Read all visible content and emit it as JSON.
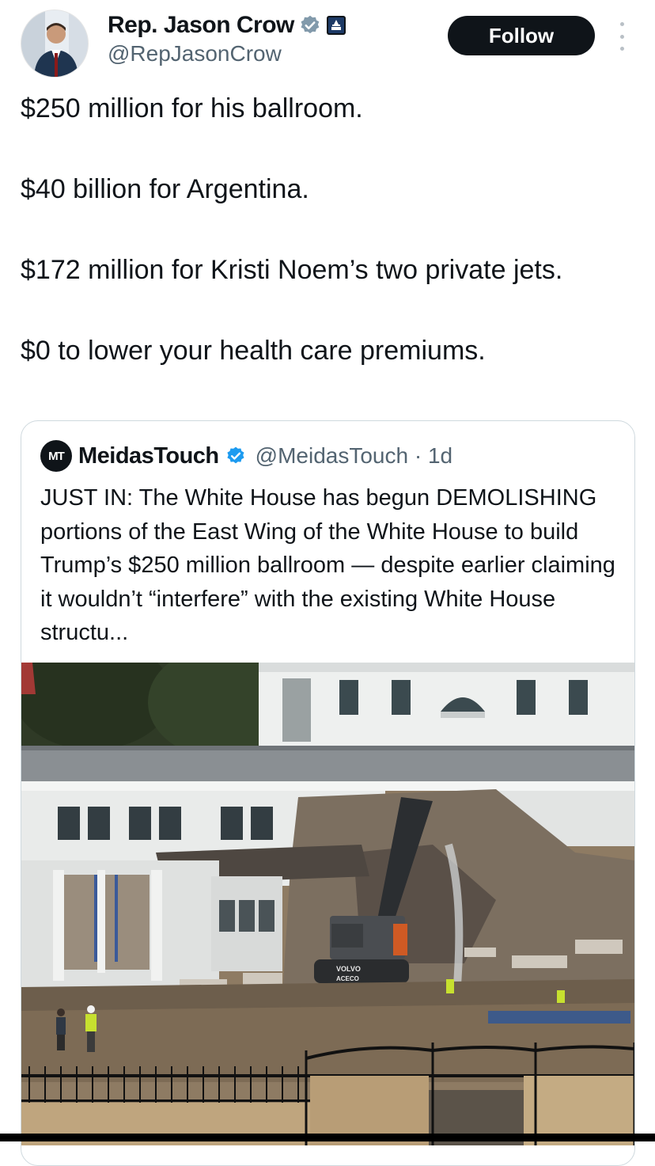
{
  "author": {
    "name": "Rep. Jason Crow",
    "handle": "@RepJasonCrow",
    "verified_color": "#829aab",
    "badge_icon": "capitol-icon"
  },
  "follow_label": "Follow",
  "tweet": {
    "paragraphs": [
      "$250 million for his ballroom.",
      "$40 billion for Argentina.",
      "$172 million for Kristi Noem’s two private jets.",
      "$0 to lower your health care premiums."
    ]
  },
  "quote": {
    "logo_text": "MT",
    "name": "MeidasTouch",
    "verified_color": "#1d9bf0",
    "meta": "@MeidasTouch · 1d",
    "text": "JUST IN: The White House has begun DEMOLISHING portions of the East Wing of the White House to build Trump’s $250 million ballroom — despite earlier claiming it wouldn’t “interfere” with the existing White House structu...",
    "image_labels": {
      "machine_brand": "VOLVO",
      "machine_text": "ACECO"
    }
  }
}
